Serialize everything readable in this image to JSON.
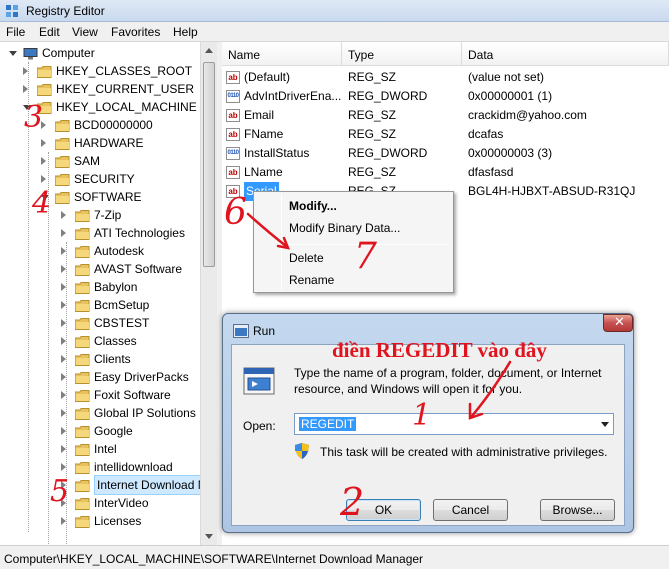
{
  "window": {
    "title": "Registry Editor"
  },
  "menu": [
    "File",
    "Edit",
    "View",
    "Favorites",
    "Help"
  ],
  "tree": {
    "items": [
      {
        "label": "Computer",
        "icon": "computer-icon",
        "level": 0,
        "expanded": true
      },
      {
        "label": "HKEY_CLASSES_ROOT",
        "level": 1
      },
      {
        "label": "HKEY_CURRENT_USER",
        "level": 1
      },
      {
        "label": "HKEY_LOCAL_MACHINE",
        "level": 1,
        "expanded": true
      },
      {
        "label": "BCD00000000",
        "level": 2
      },
      {
        "label": "HARDWARE",
        "level": 2
      },
      {
        "label": "SAM",
        "level": 2
      },
      {
        "label": "SECURITY",
        "level": 2
      },
      {
        "label": "SOFTWARE",
        "level": 2,
        "expanded": true
      },
      {
        "label": "7-Zip",
        "level": 3
      },
      {
        "label": "ATI Technologies",
        "level": 3
      },
      {
        "label": "Autodesk",
        "level": 3
      },
      {
        "label": "AVAST Software",
        "level": 3
      },
      {
        "label": "Babylon",
        "level": 3
      },
      {
        "label": "BcmSetup",
        "level": 3
      },
      {
        "label": "CBSTEST",
        "level": 3
      },
      {
        "label": "Classes",
        "level": 3
      },
      {
        "label": "Clients",
        "level": 3
      },
      {
        "label": "Easy DriverPacks",
        "level": 3
      },
      {
        "label": "Foxit Software",
        "level": 3
      },
      {
        "label": "Global IP Solutions",
        "level": 3
      },
      {
        "label": "Google",
        "level": 3
      },
      {
        "label": "Intel",
        "level": 3
      },
      {
        "label": "intellidownload",
        "level": 3
      },
      {
        "label": "Internet Download Manager",
        "level": 3,
        "selected": true
      },
      {
        "label": "InterVideo",
        "level": 3
      },
      {
        "label": "Licenses",
        "level": 3
      }
    ]
  },
  "list": {
    "headers": {
      "name": "Name",
      "type": "Type",
      "data": "Data"
    },
    "rows": [
      {
        "name": "(Default)",
        "type": "REG_SZ",
        "data": "(value not set)",
        "kind": "sz"
      },
      {
        "name": "AdvIntDriverEna...",
        "type": "REG_DWORD",
        "data": "0x00000001 (1)",
        "kind": "bin"
      },
      {
        "name": "Email",
        "type": "REG_SZ",
        "data": "crackidm@yahoo.com",
        "kind": "sz"
      },
      {
        "name": "FName",
        "type": "REG_SZ",
        "data": "dcafas",
        "kind": "sz"
      },
      {
        "name": "InstallStatus",
        "type": "REG_DWORD",
        "data": "0x00000003 (3)",
        "kind": "bin"
      },
      {
        "name": "LName",
        "type": "REG_SZ",
        "data": "dfasfasd",
        "kind": "sz"
      },
      {
        "name": "Serial",
        "type": "REG_SZ",
        "data": "BGL4H-HJBXT-ABSUD-R31QJ",
        "kind": "sz",
        "selected": true
      }
    ]
  },
  "context_menu": {
    "modify": "Modify...",
    "modify_binary": "Modify Binary Data...",
    "delete": "Delete",
    "rename": "Rename"
  },
  "status": {
    "path": "Computer\\HKEY_LOCAL_MACHINE\\SOFTWARE\\Internet Download Manager"
  },
  "run_dialog": {
    "title": "Run",
    "description": "Type the name of a program, folder, document, or Internet resource, and Windows will open it for you.",
    "open_label": "Open:",
    "open_value": "REGEDIT",
    "admin_note": "This task will be created with administrative privileges.",
    "ok": "OK",
    "cancel": "Cancel",
    "browse": "Browse..."
  },
  "annotations": {
    "instruction": "điền REGEDIT vào đây",
    "step1": "1",
    "step2": "2",
    "step3": "3",
    "step4": "4",
    "step5": "5",
    "step6": "6",
    "step7": "7"
  },
  "colors": {
    "annotation": "#e0141e",
    "selection": "#3399ff",
    "title_bar": "#c9d9ee"
  }
}
